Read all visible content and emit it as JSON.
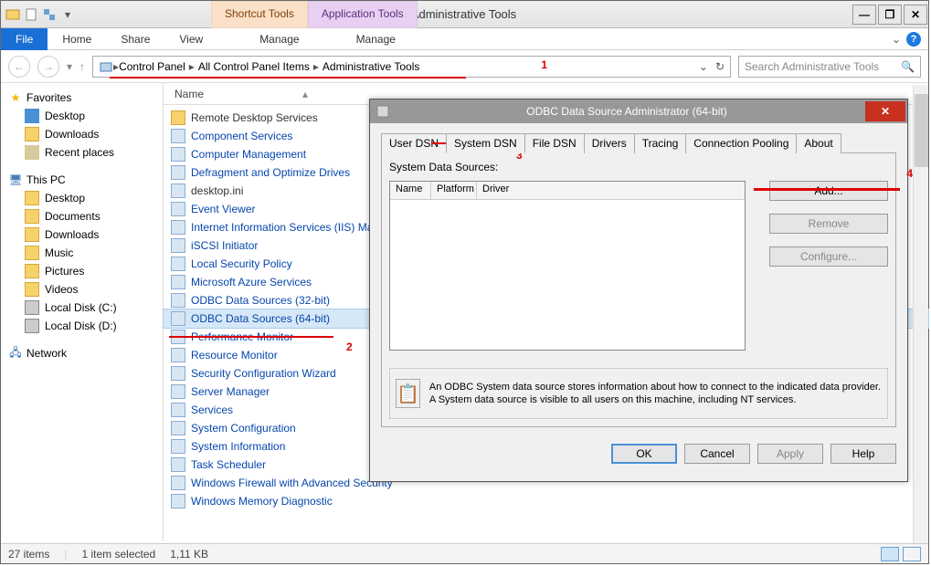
{
  "window": {
    "title": "Administrative Tools",
    "ribbon_context": {
      "shortcut": "Shortcut Tools",
      "app": "Application Tools"
    }
  },
  "menu": {
    "file": "File",
    "items": [
      "Home",
      "Share",
      "View",
      "Manage",
      "Manage"
    ]
  },
  "breadcrumb": [
    "Control Panel",
    "All Control Panel Items",
    "Administrative Tools"
  ],
  "search": {
    "placeholder": "Search Administrative Tools"
  },
  "annotations": {
    "a1": "1",
    "a2": "2",
    "a3": "3",
    "a4": "4"
  },
  "nav": {
    "favorites": {
      "label": "Favorites",
      "items": [
        "Desktop",
        "Downloads",
        "Recent places"
      ]
    },
    "thispc": {
      "label": "This PC",
      "items": [
        "Desktop",
        "Documents",
        "Downloads",
        "Music",
        "Pictures",
        "Videos",
        "Local Disk (C:)",
        "Local Disk (D:)"
      ]
    },
    "network": {
      "label": "Network"
    }
  },
  "columns": {
    "name": "Name"
  },
  "files": [
    "Remote Desktop Services",
    "Component Services",
    "Computer Management",
    "Defragment and Optimize Drives",
    "desktop.ini",
    "Event Viewer",
    "Internet Information Services (IIS) Ma",
    "iSCSI Initiator",
    "Local Security Policy",
    "Microsoft Azure Services",
    "ODBC Data Sources (32-bit)",
    "ODBC Data Sources (64-bit)",
    "Performance Monitor",
    "Resource Monitor",
    "Security Configuration Wizard",
    "Server Manager",
    "Services",
    "System Configuration",
    "System Information",
    "Task Scheduler",
    "Windows Firewall with Advanced Security",
    "Windows Memory Diagnostic"
  ],
  "status": {
    "count": "27 items",
    "sel": "1 item selected",
    "size": "1,11 KB"
  },
  "dialog": {
    "title": "ODBC Data Source Administrator (64-bit)",
    "tabs": [
      "User DSN",
      "System DSN",
      "File DSN",
      "Drivers",
      "Tracing",
      "Connection Pooling",
      "About"
    ],
    "active_tab": 1,
    "list_label": "System Data Sources:",
    "list_cols": [
      "Name",
      "Platform",
      "Driver"
    ],
    "buttons": {
      "add": "Add...",
      "remove": "Remove",
      "configure": "Configure..."
    },
    "info": "An ODBC System data source stores information about how to connect to the indicated data provider. A System data source is visible to all users on this machine, including NT services.",
    "footer": {
      "ok": "OK",
      "cancel": "Cancel",
      "apply": "Apply",
      "help": "Help"
    }
  }
}
